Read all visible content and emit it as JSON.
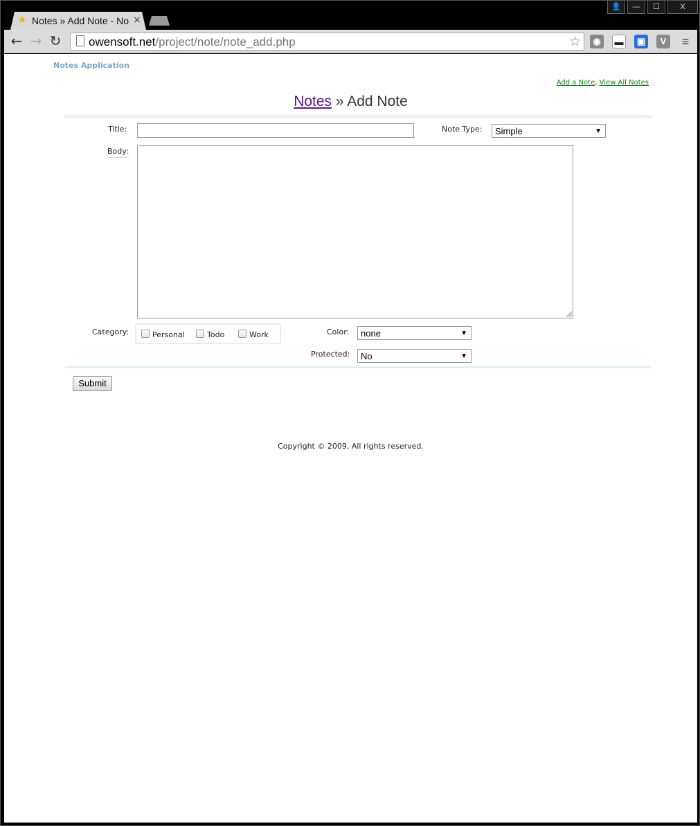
{
  "browser": {
    "tab_title": "Notes » Add Note - Not",
    "tab_close": "×",
    "url_host": "owensoft.net",
    "url_path": "/project/note/note_add.php",
    "window_buttons": {
      "profile": "👤",
      "minimize": "—",
      "maximize": "☐",
      "close": "X"
    },
    "nav": {
      "back": "←",
      "forward": "→",
      "reload": "↻",
      "star": "☆"
    },
    "extensions": [
      "camera-icon",
      "spy-icon",
      "save-icon",
      "v-icon",
      "menu-icon"
    ],
    "ext_v_label": "V"
  },
  "page": {
    "app_title": "Notes Application",
    "toplinks": {
      "add": "Add a Note",
      "sep": ",",
      "view": "View All Notes"
    },
    "heading": {
      "link": "Notes",
      "rest": " » Add Note"
    },
    "form": {
      "title_label": "Title:",
      "title_value": "",
      "note_type_label": "Note Type:",
      "note_type_value": "Simple",
      "body_label": "Body:",
      "body_value": "",
      "category_label": "Category:",
      "categories": [
        "Personal",
        "Todo",
        "Work"
      ],
      "color_label": "Color:",
      "color_value": "none",
      "protected_label": "Protected:",
      "protected_value": "No",
      "submit_label": "Submit"
    },
    "copyright": "Copyright © 2009, All rights reserved."
  },
  "colors": {
    "app_title": "#7ca7c9",
    "link_green": "#1f7a1f",
    "visited_link": "#551a8b"
  }
}
